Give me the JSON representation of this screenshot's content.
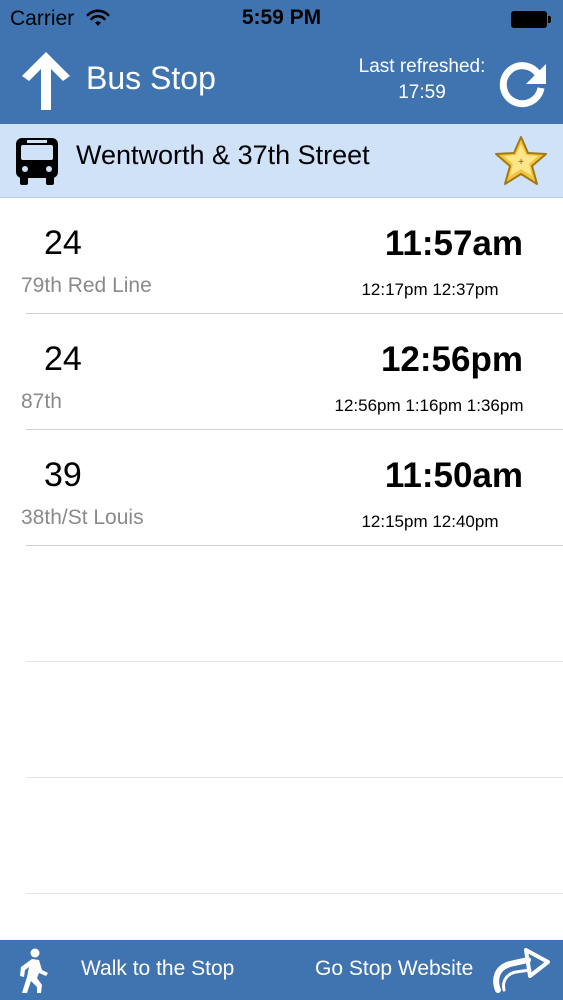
{
  "status_bar": {
    "carrier": "Carrier",
    "time": "5:59 PM"
  },
  "nav": {
    "title": "Bus Stop",
    "refresh_caption": "Last refreshed:",
    "refresh_time": "17:59"
  },
  "stop": {
    "name": "Wentworth & 37th Street"
  },
  "arrivals": [
    {
      "route": "24",
      "destination": "79th Red Line",
      "next": "11:57am",
      "later": "12:17pm 12:37pm"
    },
    {
      "route": "24",
      "destination": "87th",
      "next": "12:56pm",
      "later": "12:56pm 1:16pm 1:36pm"
    },
    {
      "route": "39",
      "destination": "38th/St Louis",
      "next": "11:50am",
      "later": "12:15pm 12:40pm"
    }
  ],
  "toolbar": {
    "walk_label": "Walk to the Stop",
    "website_label": "Go Stop Website"
  },
  "icons": {
    "back": "up-arrow-icon",
    "refresh": "refresh-icon",
    "bus": "bus-icon",
    "favorite": "star-icon",
    "walk": "walking-person-icon",
    "website": "share-arrow-icon"
  },
  "colors": {
    "bar": "#3f74b0",
    "stop_header": "#cfe2f8",
    "star": "#f5c542"
  }
}
